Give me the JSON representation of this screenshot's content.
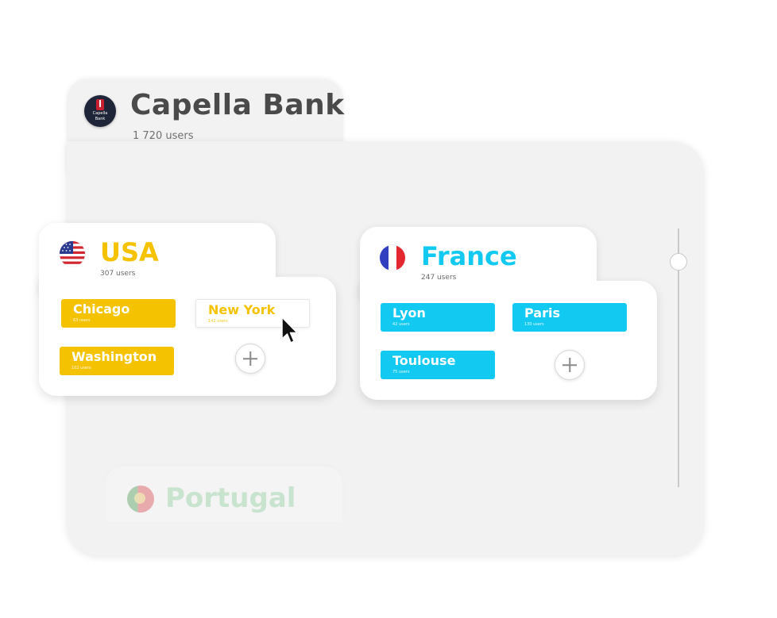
{
  "company": {
    "name": "Capella Bank",
    "users": "1 720 users",
    "logo_text_line1": "Capella",
    "logo_text_line2": "Bank"
  },
  "colors": {
    "usa_accent": "#f5c200",
    "france_accent": "#12c9f2",
    "portugal_accent": "#7dc98e",
    "heading": "#4a4a4a"
  },
  "countries": [
    {
      "name": "USA",
      "users": "307 users",
      "flag_icon": "usa-flag-icon",
      "cities": [
        {
          "name": "Chicago",
          "users": "63 users"
        },
        {
          "name": "New York",
          "users": "142 users"
        },
        {
          "name": "Washington",
          "users": "102 users"
        }
      ]
    },
    {
      "name": "France",
      "users": "247 users",
      "flag_icon": "france-flag-icon",
      "cities": [
        {
          "name": "Lyon",
          "users": "42 users"
        },
        {
          "name": "Paris",
          "users": "130 users"
        },
        {
          "name": "Toulouse",
          "users": "75 users"
        }
      ]
    },
    {
      "name": "Portugal",
      "flag_icon": "portugal-flag-icon"
    }
  ],
  "scrollbar": {
    "position_percent": 10
  }
}
